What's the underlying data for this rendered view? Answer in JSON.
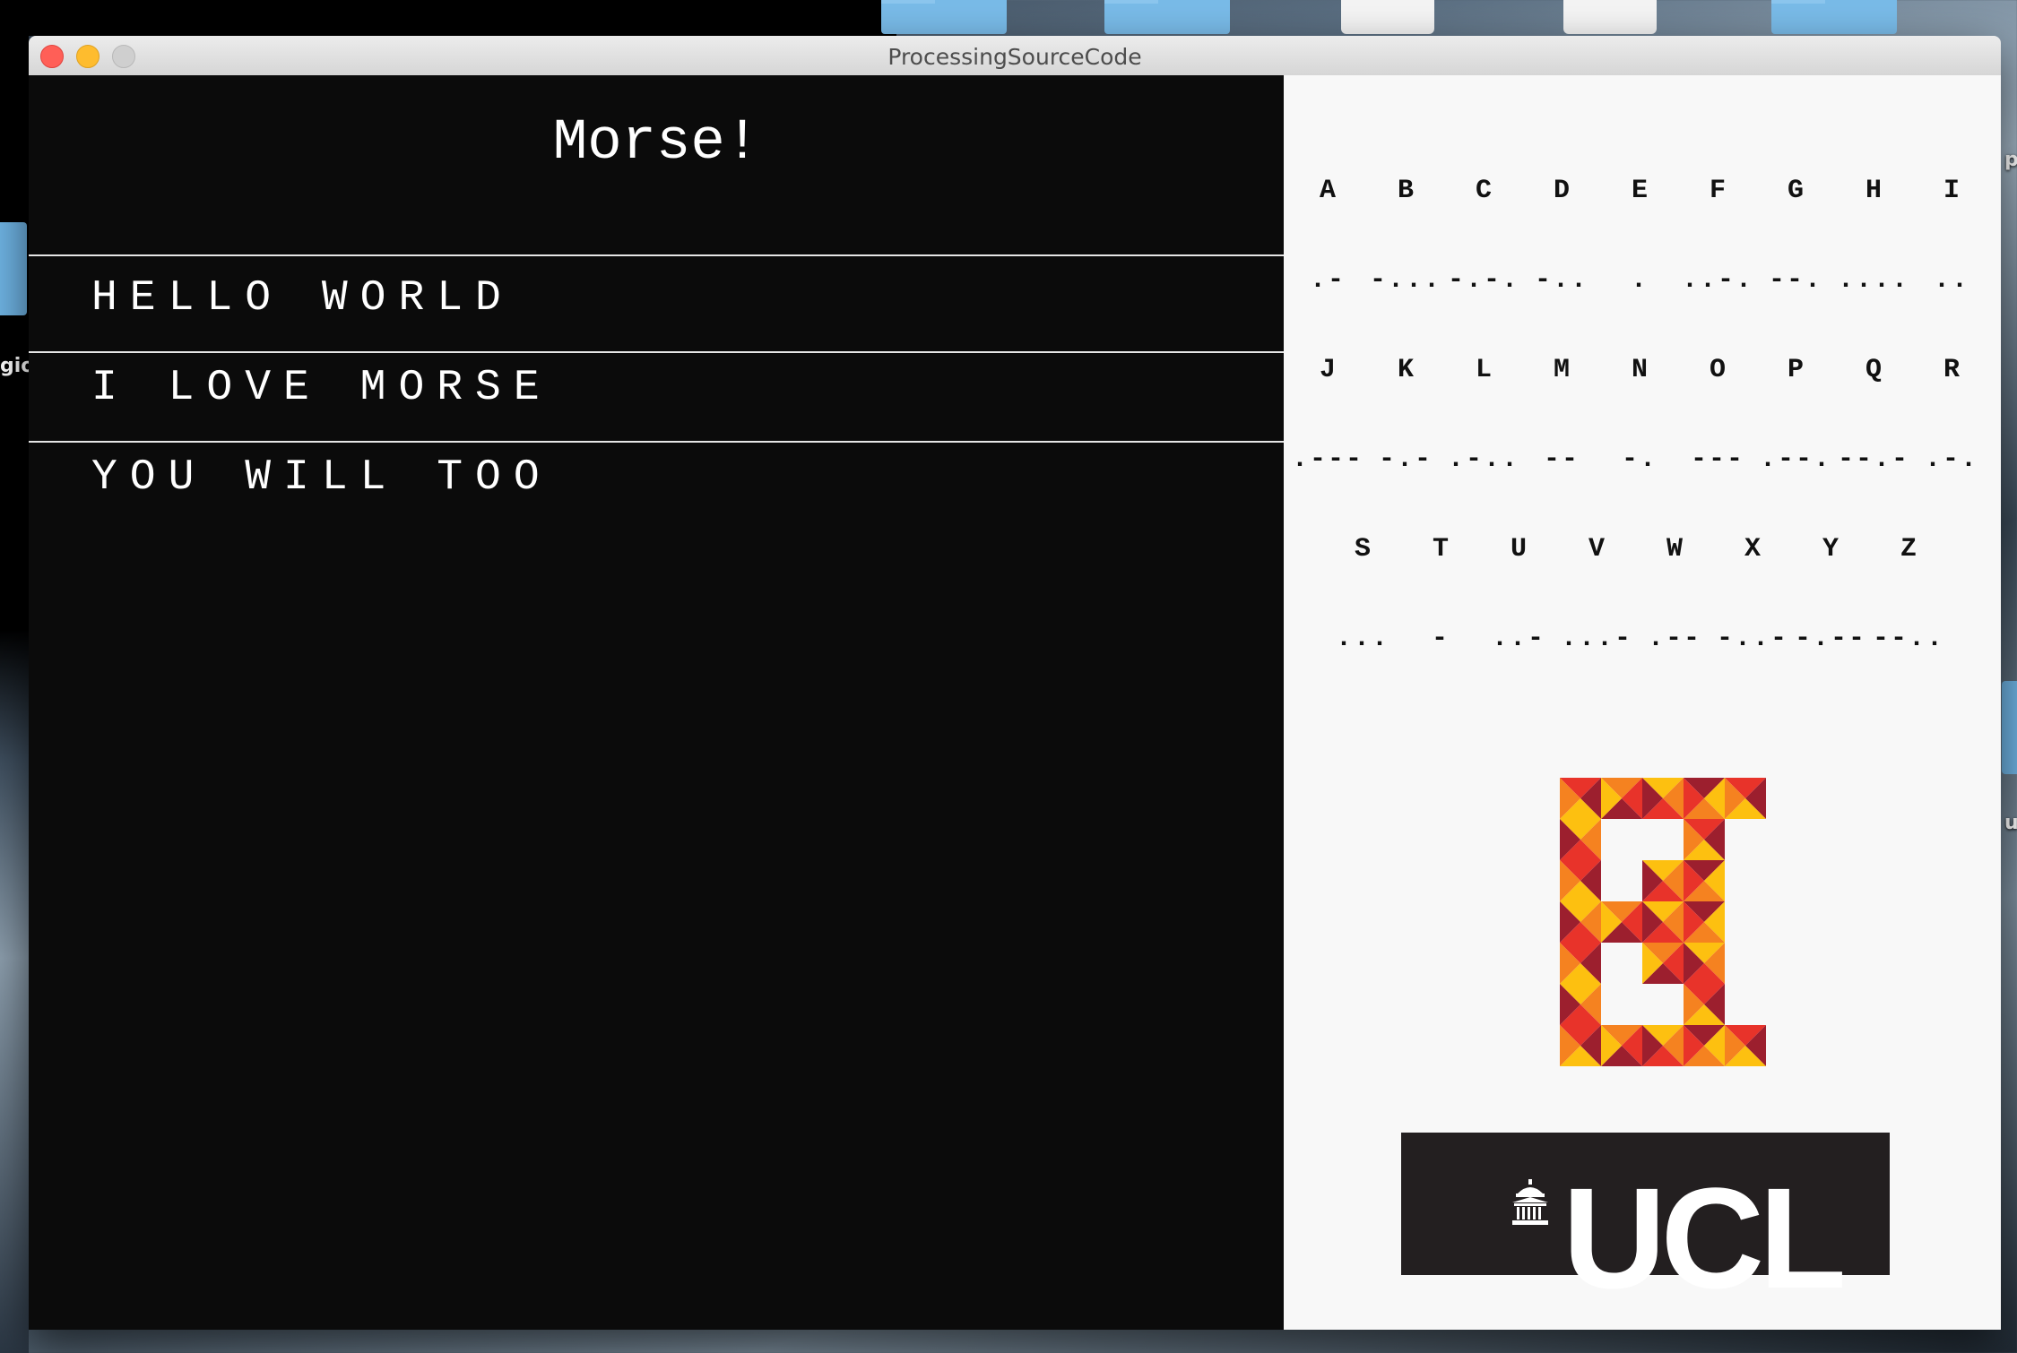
{
  "window": {
    "title": "ProcessingSourceCode"
  },
  "desktop": {
    "labels": [
      "gio",
      "p",
      "u"
    ]
  },
  "main": {
    "heading": "Morse!",
    "messages": [
      "HELLO WORLD",
      "I LOVE MORSE",
      "YOU WILL TOO"
    ]
  },
  "morse_chart": {
    "rows": [
      {
        "letters": [
          "A",
          "B",
          "C",
          "D",
          "E",
          "F",
          "G",
          "H",
          "I"
        ],
        "codes": [
          ".-",
          "-...",
          "-.-.",
          "-..",
          ".",
          "..-.",
          "--.",
          "....",
          ".."
        ]
      },
      {
        "letters": [
          "J",
          "K",
          "L",
          "M",
          "N",
          "O",
          "P",
          "Q",
          "R"
        ],
        "codes": [
          ".---",
          "-.-",
          ".-..",
          "--",
          "-.",
          "---",
          ".--.",
          "--.-",
          ".-."
        ]
      },
      {
        "letters": [
          "S",
          "T",
          "U",
          "V",
          "W",
          "X",
          "Y",
          "Z"
        ],
        "codes": [
          "...",
          "-",
          "..-",
          "...-",
          ".--",
          "-..-",
          "-.--",
          "--.."
        ]
      }
    ]
  },
  "logos": {
    "institution": "UCL"
  },
  "colors": {
    "background": "#0b0b0b",
    "panel": "#f8f8f8",
    "logo_red": "#e8332a",
    "logo_orange": "#f58220",
    "logo_yellow": "#fdc010",
    "logo_dark": "#9c1f2e"
  }
}
